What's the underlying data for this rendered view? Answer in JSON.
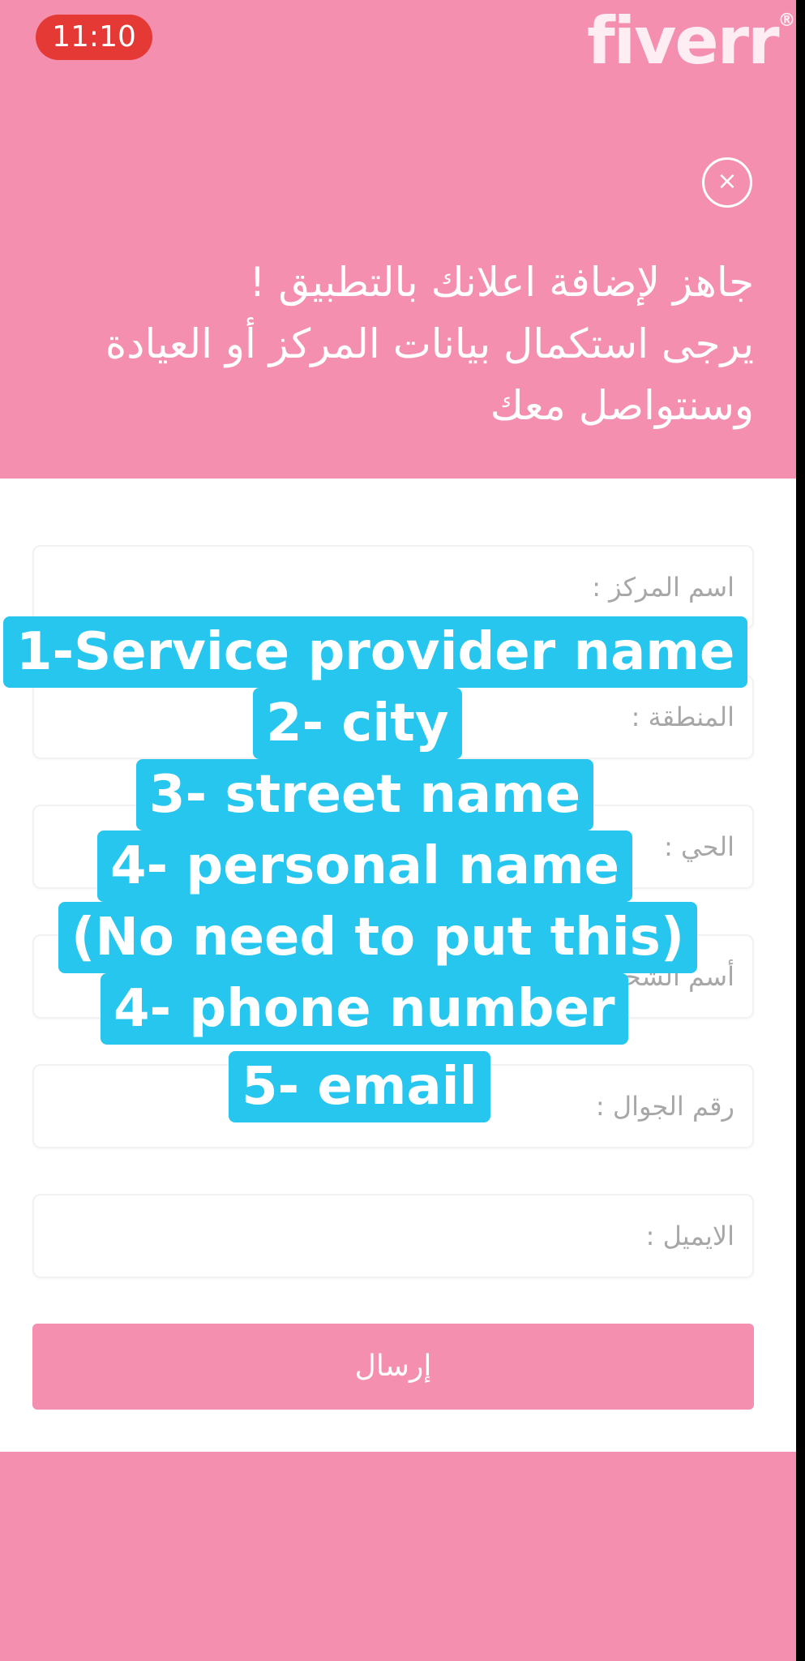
{
  "status_bar": {
    "time": "11:10"
  },
  "brand": {
    "logo_text": "fiverr",
    "registered": "®"
  },
  "modal": {
    "close_icon": "close-icon",
    "close_glyph": "×",
    "headline": [
      "جاهز لإضافة اعلانك بالتطبيق !",
      "يرجى استكمال بيانات المركز أو العيادة",
      "وسنتواصل معك"
    ],
    "fields": [
      {
        "label": "اسم المركز :"
      },
      {
        "label": "المنطقة :"
      },
      {
        "label": "الحي :"
      },
      {
        "label": "أسم الشخص :"
      },
      {
        "label": "رقم الجوال :"
      },
      {
        "label": "الايميل :"
      }
    ],
    "submit_label": "إرسال"
  },
  "overlay": {
    "lines": [
      "1-Service provider name",
      "2- city",
      "3- street name",
      "4- personal name",
      "(No need to put this)",
      "4- phone number",
      "5- email"
    ]
  },
  "colors": {
    "header_pink": "#f48fb0",
    "overlay_cyan": "#26c6ee",
    "time_pill_red": "#e53935"
  }
}
